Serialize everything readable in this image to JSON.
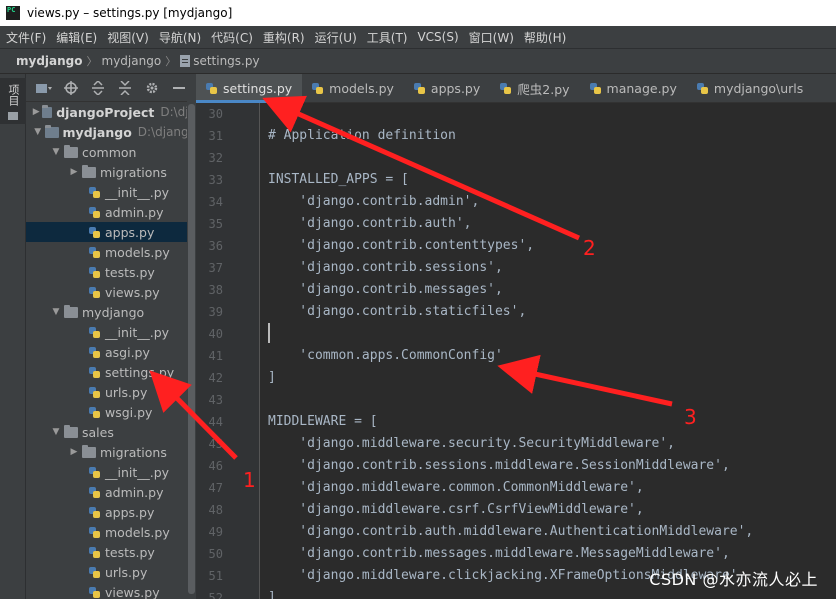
{
  "window": {
    "title": "views.py – settings.py [mydjango]",
    "logo": "PC"
  },
  "menubar": {
    "items": [
      "文件(F)",
      "编辑(E)",
      "视图(V)",
      "导航(N)",
      "代码(C)",
      "重构(R)",
      "运行(U)",
      "工具(T)",
      "VCS(S)",
      "窗口(W)",
      "帮助(H)"
    ]
  },
  "breadcrumb": {
    "project": "mydjango",
    "folder": "mydjango",
    "file": "settings.py"
  },
  "sidebar": {
    "tab_label": "项目",
    "tab_icon": "folder-icon"
  },
  "project_toolbar": [
    "project-view-dropdown-icon",
    "locate-icon",
    "expand-all-icon",
    "collapse-all-icon",
    "settings-gear-icon",
    "hide-icon"
  ],
  "tree": [
    {
      "label": "djangoProject",
      "path": "D:\\dja",
      "type": "root"
    },
    {
      "label": "mydjango",
      "path": "D:\\django",
      "type": "root"
    },
    {
      "label": "common",
      "type": "folder"
    },
    {
      "label": "migrations",
      "type": "folder"
    },
    {
      "label": "__init__.py",
      "type": "file"
    },
    {
      "label": "admin.py",
      "type": "file"
    },
    {
      "label": "apps.py",
      "type": "file"
    },
    {
      "label": "models.py",
      "type": "file"
    },
    {
      "label": "tests.py",
      "type": "file"
    },
    {
      "label": "views.py",
      "type": "file"
    },
    {
      "label": "mydjango",
      "type": "folder"
    },
    {
      "label": "__init__.py",
      "type": "file"
    },
    {
      "label": "asgi.py",
      "type": "file"
    },
    {
      "label": "settings.py",
      "type": "file"
    },
    {
      "label": "urls.py",
      "type": "file"
    },
    {
      "label": "wsgi.py",
      "type": "file"
    },
    {
      "label": "sales",
      "type": "folder"
    },
    {
      "label": "migrations",
      "type": "folder"
    },
    {
      "label": "__init__.py",
      "type": "file"
    },
    {
      "label": "admin.py",
      "type": "file"
    },
    {
      "label": "apps.py",
      "type": "file"
    },
    {
      "label": "models.py",
      "type": "file"
    },
    {
      "label": "tests.py",
      "type": "file"
    },
    {
      "label": "urls.py",
      "type": "file"
    },
    {
      "label": "views.py",
      "type": "file"
    }
  ],
  "tabs": [
    "settings.py",
    "models.py",
    "apps.py",
    "爬虫2.py",
    "manage.py",
    "mydjango\\urls"
  ],
  "editor": {
    "line_numbers": [
      "30",
      "31",
      "32",
      "33",
      "34",
      "35",
      "36",
      "37",
      "38",
      "39",
      "40",
      "41",
      "42",
      "43",
      "44",
      "45",
      "46",
      "47",
      "48",
      "49",
      "50",
      "51",
      "52"
    ],
    "lines": [
      "",
      "# Application definition",
      "",
      "INSTALLED_APPS = [",
      "    'django.contrib.admin',",
      "    'django.contrib.auth',",
      "    'django.contrib.contenttypes',",
      "    'django.contrib.sessions',",
      "    'django.contrib.messages',",
      "    'django.contrib.staticfiles',",
      "",
      "    'common.apps.CommonConfig'",
      "]",
      "",
      "MIDDLEWARE = [",
      "    'django.middleware.security.SecurityMiddleware',",
      "    'django.contrib.sessions.middleware.SessionMiddleware',",
      "    'django.middleware.common.CommonMiddleware',",
      "    'django.middleware.csrf.CsrfViewMiddleware',",
      "    'django.contrib.auth.middleware.AuthenticationMiddleware',",
      "    'django.contrib.messages.middleware.MessageMiddleware',",
      "    'django.middleware.clickjacking.XFrameOptionsMiddleware',",
      "]"
    ]
  },
  "annotations": {
    "label_1": "1",
    "label_2": "2",
    "label_3": "3",
    "color": "#ff2020"
  },
  "watermark": "CSDN @水亦流人必上"
}
